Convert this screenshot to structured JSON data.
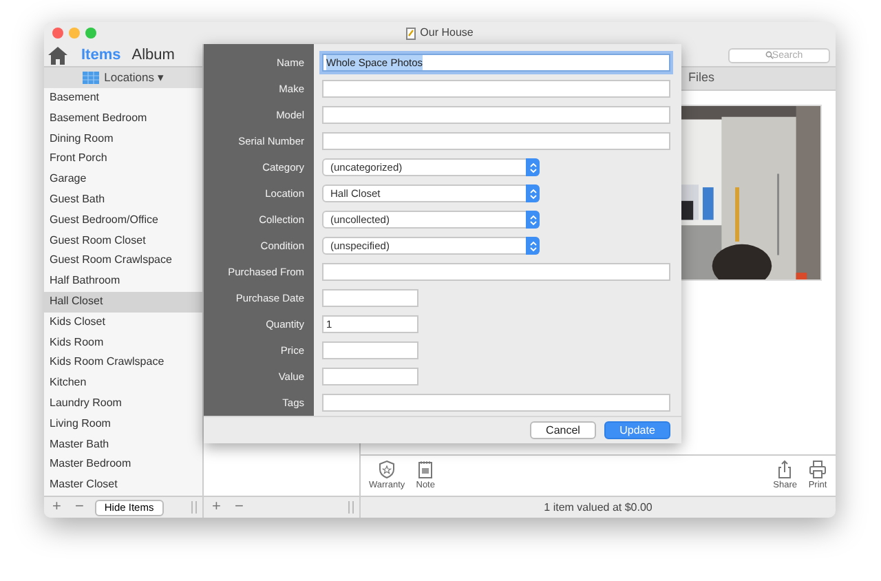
{
  "window": {
    "title": "Our House"
  },
  "sidebar": {
    "tabs": [
      {
        "label": "Items",
        "selected": true
      },
      {
        "label": "Album",
        "selected": false
      }
    ],
    "header": "Locations ▾",
    "items": [
      {
        "label": "Basement",
        "selected": false
      },
      {
        "label": "Basement Bedroom",
        "selected": false
      },
      {
        "label": "Dining Room",
        "selected": false
      },
      {
        "label": "Front Porch",
        "selected": false
      },
      {
        "label": "Garage",
        "selected": false
      },
      {
        "label": "Guest Bath",
        "selected": false
      },
      {
        "label": "Guest Bedroom/Office",
        "selected": false
      },
      {
        "label": "Guest Room Closet",
        "selected": false
      },
      {
        "label": "Guest Room Crawlspace",
        "selected": false
      },
      {
        "label": "Half Bathroom",
        "selected": false
      },
      {
        "label": "Hall Closet",
        "selected": true
      },
      {
        "label": "Kids Closet",
        "selected": false
      },
      {
        "label": "Kids Room",
        "selected": false
      },
      {
        "label": "Kids Room Crawlspace",
        "selected": false
      },
      {
        "label": "Kitchen",
        "selected": false
      },
      {
        "label": "Laundry Room",
        "selected": false
      },
      {
        "label": "Living Room",
        "selected": false
      },
      {
        "label": "Master Bath",
        "selected": false
      },
      {
        "label": "Master Bedroom",
        "selected": false
      },
      {
        "label": "Master Closet",
        "selected": false
      }
    ],
    "bottom": {
      "add": "+",
      "remove": "−",
      "hide_button": "Hide Items"
    }
  },
  "middle": {
    "bottom": {
      "add": "+",
      "remove": "−"
    }
  },
  "detail": {
    "search": {
      "placeholder": "Search"
    },
    "tab": "Files",
    "toolbar": [
      {
        "label": "Warranty",
        "kind": "warranty"
      },
      {
        "label": "Note",
        "kind": "note"
      },
      {
        "label": "Share",
        "kind": "share"
      },
      {
        "label": "Print",
        "kind": "print"
      }
    ],
    "status_bar": "1 item valued at $0.00"
  },
  "sheet": {
    "fields": [
      {
        "label": "Name",
        "kind": "text",
        "value": "Whole Space Photos",
        "focused": true
      },
      {
        "label": "Make",
        "kind": "text"
      },
      {
        "label": "Model",
        "kind": "text"
      },
      {
        "label": "Serial Number",
        "kind": "text"
      },
      {
        "label": "Category",
        "kind": "select",
        "value": "(uncategorized)"
      },
      {
        "label": "Location",
        "kind": "select",
        "value": "Hall Closet"
      },
      {
        "label": "Collection",
        "kind": "select",
        "value": "(uncollected)"
      },
      {
        "label": "Condition",
        "kind": "select",
        "value": "(unspecified)"
      },
      {
        "label": "Purchased From",
        "kind": "text"
      },
      {
        "label": "Purchase Date",
        "kind": "short"
      },
      {
        "label": "Quantity",
        "kind": "short",
        "value": "1"
      },
      {
        "label": "Price",
        "kind": "short"
      },
      {
        "label": "Value",
        "kind": "short"
      },
      {
        "label": "Tags",
        "kind": "text"
      }
    ],
    "buttons": [
      {
        "label": "Cancel",
        "kind": "secondary"
      },
      {
        "label": "Update",
        "kind": "primary"
      }
    ]
  }
}
